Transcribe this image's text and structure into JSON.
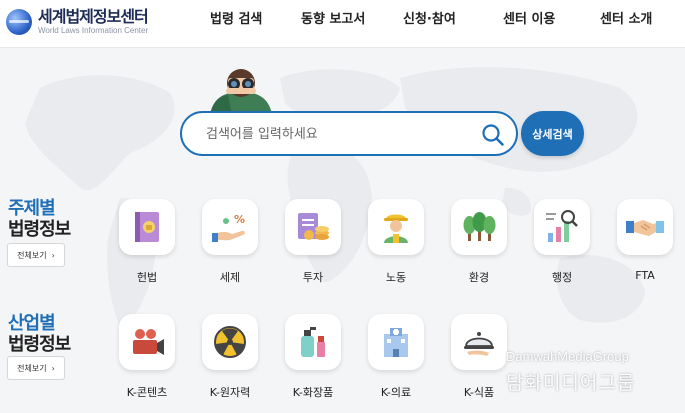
{
  "header": {
    "logo_title": "세계법제정보센터",
    "logo_subtitle": "World Laws Information Center",
    "nav": [
      "법령 검색",
      "동향 보고서",
      "신청·참여",
      "센터 이용",
      "센터 소개"
    ]
  },
  "search": {
    "placeholder": "검색어를 입력하세요",
    "detail_button": "상세검색"
  },
  "topic_section": {
    "title_line1": "주제별",
    "title_line2": "법령정보",
    "view_all": "전체보기",
    "view_all_arrow": "›",
    "items": [
      {
        "label": "헌법",
        "icon": "constitution-book-icon"
      },
      {
        "label": "세제",
        "icon": "tax-hand-icon"
      },
      {
        "label": "투자",
        "icon": "investment-icon"
      },
      {
        "label": "노동",
        "icon": "labor-worker-icon"
      },
      {
        "label": "환경",
        "icon": "environment-trees-icon"
      },
      {
        "label": "행정",
        "icon": "administration-chart-icon"
      },
      {
        "label": "FTA",
        "icon": "fta-handshake-icon"
      }
    ]
  },
  "industry_section": {
    "title_line1": "산업별",
    "title_line2": "법령정보",
    "view_all": "전체보기",
    "view_all_arrow": "›",
    "items": [
      {
        "label": "K-콘텐츠",
        "icon": "video-camera-icon"
      },
      {
        "label": "K-원자력",
        "icon": "radiation-icon"
      },
      {
        "label": "K-화장품",
        "icon": "cosmetics-icon"
      },
      {
        "label": "K-의료",
        "icon": "hospital-icon"
      },
      {
        "label": "K-식품",
        "icon": "food-cloche-icon"
      }
    ]
  },
  "watermark": {
    "english": "DamwahMediaGroup",
    "korean": "담화미디어그룹"
  },
  "colors": {
    "accent": "#1f6fb6",
    "background": "#f4f5f7"
  }
}
